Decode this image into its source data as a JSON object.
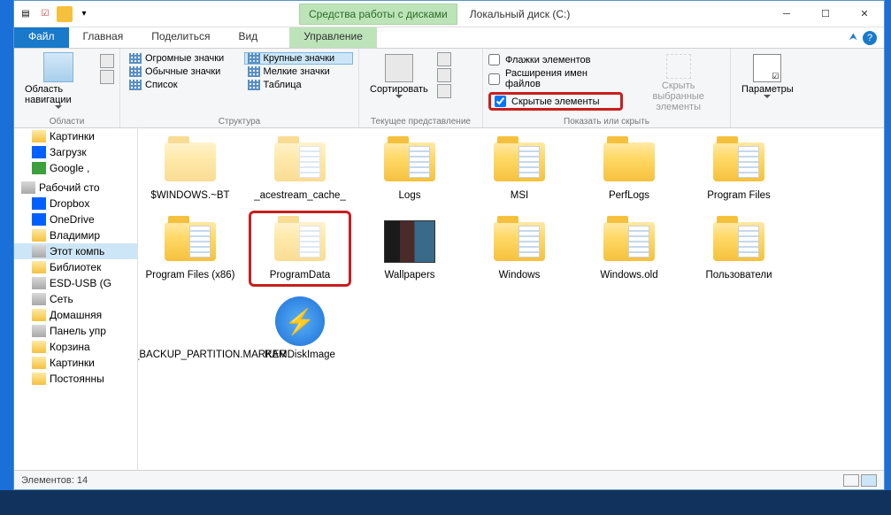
{
  "titlebar": {
    "context_tab": "Средства работы с дисками",
    "title": "Локальный диск (C:)"
  },
  "menubar": {
    "file": "Файл",
    "tabs": [
      "Главная",
      "Поделиться",
      "Вид"
    ],
    "context_tab": "Управление"
  },
  "ribbon": {
    "nav_group": {
      "button": "Область навигации",
      "label": "Области"
    },
    "layout_group": {
      "options": [
        "Огромные значки",
        "Крупные значки",
        "Обычные значки",
        "Мелкие значки",
        "Список",
        "Таблица"
      ],
      "selected": "Крупные значки",
      "label": "Структура"
    },
    "view_group": {
      "sort": "Сортировать",
      "label": "Текущее представление"
    },
    "show_group": {
      "checks": [
        {
          "label": "Флажки элементов",
          "checked": false
        },
        {
          "label": "Расширения имен файлов",
          "checked": false
        },
        {
          "label": "Скрытые элементы",
          "checked": true,
          "highlight": true
        }
      ],
      "hide_btn": "Скрыть выбранные элементы",
      "label": "Показать или скрыть"
    },
    "options": {
      "button": "Параметры"
    }
  },
  "sidebar": {
    "items": [
      {
        "label": "Картинки",
        "icon": "fold-y"
      },
      {
        "label": "Загрузк",
        "icon": "drop-b"
      },
      {
        "label": "Google ,",
        "icon": "net-b"
      },
      {
        "label": "Рабочий сто",
        "icon": "drive-b",
        "root": true
      },
      {
        "label": "Dropbox",
        "icon": "drop-b"
      },
      {
        "label": "OneDrive",
        "icon": "drop-b"
      },
      {
        "label": "Владимир",
        "icon": "fold-y"
      },
      {
        "label": "Этот компь",
        "icon": "drive-b",
        "sel": true
      },
      {
        "label": "Библиотек",
        "icon": "fold-y"
      },
      {
        "label": "ESD-USB (G",
        "icon": "drive-b"
      },
      {
        "label": "Сеть",
        "icon": "drive-b"
      },
      {
        "label": "Домашняя",
        "icon": "fold-y"
      },
      {
        "label": "Панель упр",
        "icon": "drive-b"
      },
      {
        "label": "Корзина",
        "icon": "fold-y"
      },
      {
        "label": "Картинки",
        "icon": "fold-y"
      },
      {
        "label": "Постоянны",
        "icon": "fold-y"
      }
    ]
  },
  "content": {
    "items": [
      {
        "name": "$WINDOWS.~BT",
        "type": "folder",
        "hidden": true
      },
      {
        "name": "_acestream_cache_",
        "type": "folder",
        "hidden": true,
        "docs": true
      },
      {
        "name": "Logs",
        "type": "folder-docs"
      },
      {
        "name": "MSI",
        "type": "folder-docs"
      },
      {
        "name": "PerfLogs",
        "type": "folder"
      },
      {
        "name": "Program Files",
        "type": "folder-docs"
      },
      {
        "name": "Program Files (x86)",
        "type": "folder-docs"
      },
      {
        "name": "ProgramData",
        "type": "folder",
        "hidden": true,
        "highlight": true,
        "docs": true
      },
      {
        "name": "Wallpapers",
        "type": "wallpaper"
      },
      {
        "name": "Windows",
        "type": "folder-docs"
      },
      {
        "name": "Windows.old",
        "type": "folder-docs"
      },
      {
        "name": "Пользователи",
        "type": "folder-docs"
      },
      {
        "name": "$WINRE_BACKUP_PARTITION.MARKER",
        "type": "blank"
      },
      {
        "name": "RAMDiskImage",
        "type": "ramdisk"
      }
    ]
  },
  "statusbar": {
    "text": "Элементов: 14"
  }
}
